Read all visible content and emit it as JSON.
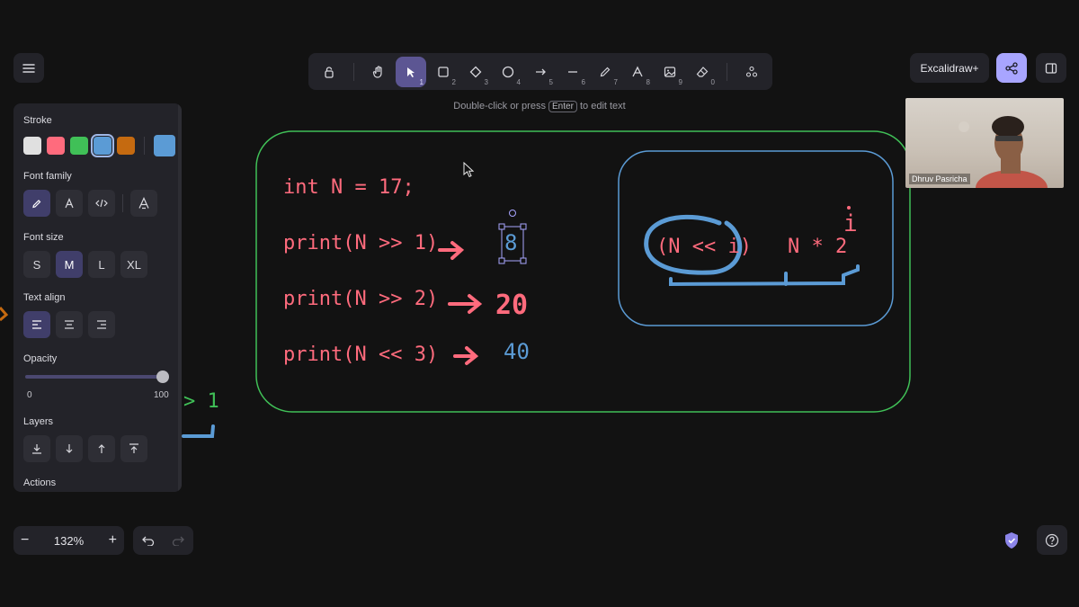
{
  "toolbar": {
    "tools": [
      {
        "name": "lock",
        "key": ""
      },
      {
        "name": "hand",
        "key": ""
      },
      {
        "name": "selection",
        "key": "1"
      },
      {
        "name": "rectangle",
        "key": "2"
      },
      {
        "name": "diamond",
        "key": "3"
      },
      {
        "name": "ellipse",
        "key": "4"
      },
      {
        "name": "arrow",
        "key": "5"
      },
      {
        "name": "line",
        "key": "6"
      },
      {
        "name": "draw",
        "key": "7"
      },
      {
        "name": "text",
        "key": "8"
      },
      {
        "name": "image",
        "key": "9"
      },
      {
        "name": "eraser",
        "key": "0"
      },
      {
        "name": "extra-tools",
        "key": ""
      }
    ],
    "active_tool": "selection"
  },
  "hint": {
    "prefix": "Double-click or press",
    "key": "Enter",
    "suffix": "to edit text"
  },
  "header": {
    "excalidraw_plus": "Excalidraw+"
  },
  "video": {
    "participant_name": "Dhruv Pasricha"
  },
  "props": {
    "stroke_label": "Stroke",
    "stroke_colors": [
      "#e0e0e0",
      "#ff6b7d",
      "#40c057",
      "#5b9bd5",
      "#c56a10"
    ],
    "current_stroke": "#5b9bd5",
    "font_family_label": "Font family",
    "font_size_label": "Font size",
    "font_sizes": [
      "S",
      "M",
      "L",
      "XL"
    ],
    "font_size_selected": "M",
    "text_align_label": "Text align",
    "opacity_label": "Opacity",
    "opacity_min": "0",
    "opacity_max": "100",
    "opacity_value": 100,
    "layers_label": "Layers",
    "actions_label": "Actions"
  },
  "canvas": {
    "line1": "int N = 17;",
    "line2": "print(N >> 1)",
    "line3": "print(N >> 2)",
    "line4": "print(N << 3)",
    "result1": "8",
    "result2": "20",
    "result3": "40",
    "formula_left": "(N << i)",
    "formula_right": "N * 2",
    "exponent": "i",
    "offscreen_text": "> 1",
    "colors": {
      "red": "#ff6b7d",
      "blue": "#5b9bd5",
      "green": "#40c057"
    }
  },
  "footer": {
    "zoom": "132%"
  }
}
